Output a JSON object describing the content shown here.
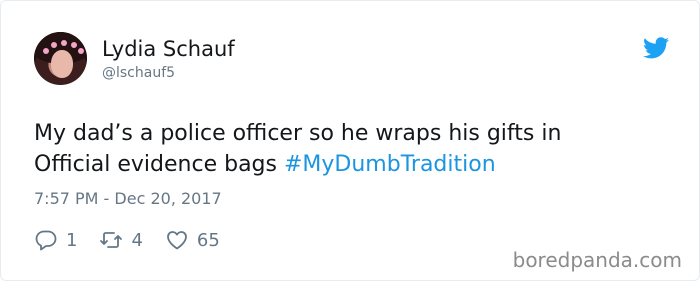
{
  "tweet": {
    "author": {
      "name": "Lydia Schauf",
      "handle": "@lschauf5"
    },
    "text_line1": "My dad’s a police officer so he wraps his gifts in",
    "text_line2_prefix": "Official evidence bags ",
    "hashtag": "#MyDumbTradition",
    "timestamp": "7:57 PM - Dec 20, 2017",
    "stats": {
      "replies": "1",
      "retweets": "4",
      "likes": "65"
    }
  },
  "watermark": "boredpanda.com",
  "colors": {
    "text": "#14171a",
    "secondary": "#657786",
    "link": "#1b95e0",
    "twitter_blue": "#1da1f2"
  },
  "icons": {
    "brand": "twitter-bird-icon",
    "reply": "reply-icon",
    "retweet": "retweet-icon",
    "like": "heart-icon"
  }
}
